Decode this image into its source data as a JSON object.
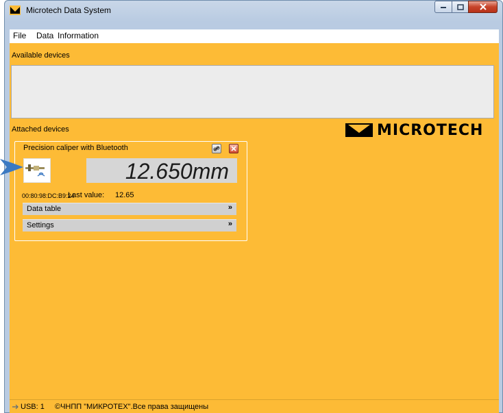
{
  "window": {
    "title": "Microtech Data System"
  },
  "menu": [
    "File",
    "Data",
    "Information"
  ],
  "sections": {
    "available": "Available devices",
    "attached": "Attached devices"
  },
  "logo": {
    "text": "MICROTECH"
  },
  "device": {
    "title": "Precision caliper with Bluetooth",
    "reading": "12.650mm",
    "mac": "00:80:98:DC:B9:24",
    "last_value_label": "Last value:",
    "last_value": "12.65",
    "expanders": [
      "Data table",
      "Settings"
    ]
  },
  "status": {
    "usb": "USB: 1",
    "copyright": "©ЧНПП \"МИКРОТЕХ\".Все права защищены"
  },
  "colors": {
    "accent": "#fdbb36",
    "panel": "#ececec",
    "arrow": "#3b79c2"
  }
}
